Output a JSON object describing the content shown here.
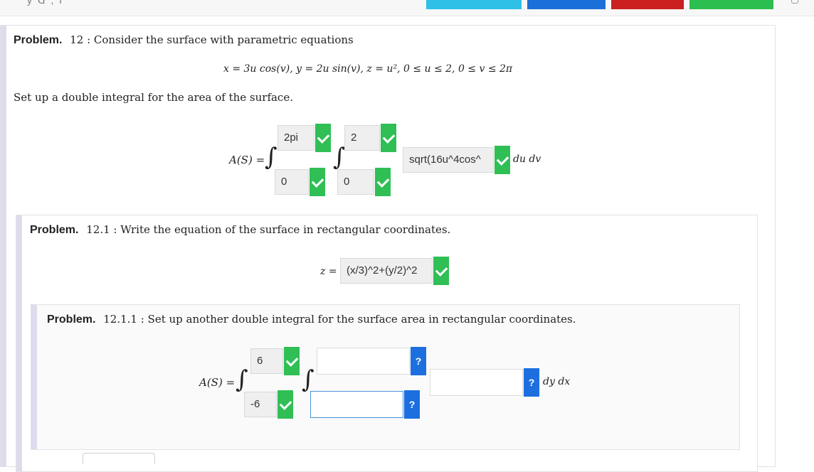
{
  "topbar": {
    "truncated_text": "y ᗡ ,   ǀ",
    "buttons": [
      {
        "color": "#2fc0e8"
      },
      {
        "color": "#1b6fd8"
      },
      {
        "color": "#cc1f1f"
      },
      {
        "color": "#2cbe4e"
      }
    ]
  },
  "problem12": {
    "heading": "Problem.",
    "number_text": "12 : Consider the surface with parametric equations",
    "equation": "x = 3u cos(v),   y = 2u sin(v),   z = u²,   0 ≤ u ≤ 2,  0 ≤ v ≤ 2π",
    "instruction": "Set up a double integral for the area of the surface.",
    "lhs": "A(S) =",
    "integral_sign": "∫",
    "outer_upper": "2pi",
    "outer_lower": "0",
    "inner_upper": "2",
    "inner_lower": "0",
    "integrand": "sqrt(16u^4cos^",
    "differentials": "du dv"
  },
  "problem12_1": {
    "heading": "Problem.",
    "number_text": "12.1 : Write the equation of the surface in rectangular coordinates.",
    "lhs": "z =",
    "answer": "(x/3)^2+(y/2)^2"
  },
  "problem12_1_1": {
    "heading": "Problem.",
    "number_text": "12.1.1 : Set up another double integral for the surface area in rectangular coordinates.",
    "lhs": "A(S) =",
    "integral_sign": "∫",
    "outer_upper": "6",
    "outer_lower": "-6",
    "inner_upper": "",
    "inner_lower": "",
    "integrand": "",
    "differentials": "dy dx",
    "unknown_mark": "?"
  },
  "colors": {
    "correct": "#2fbf55",
    "unanswered": "#1d6fe0",
    "focus_border": "#4a90d9"
  }
}
